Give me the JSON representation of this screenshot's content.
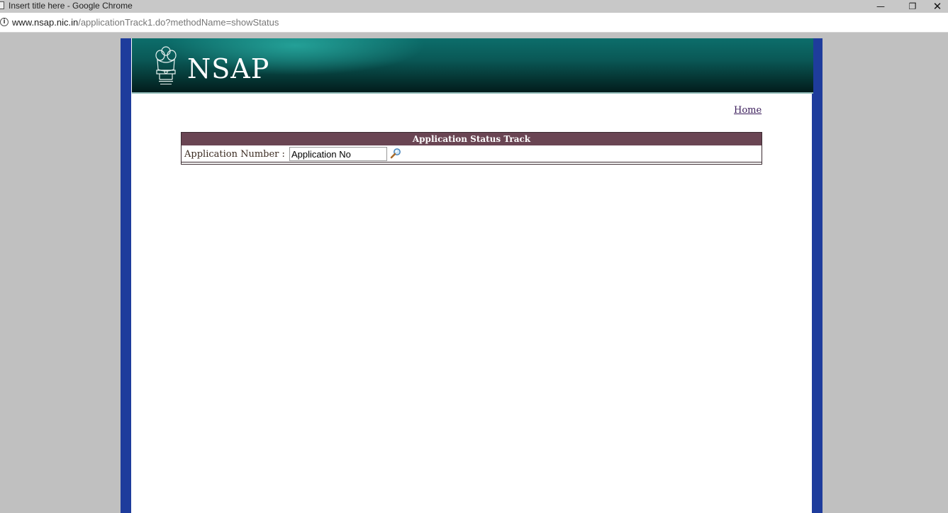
{
  "window": {
    "title": "Insert title here - Google Chrome",
    "minimize_glyph": "—",
    "restore_glyph": "❐",
    "close_glyph": "✕"
  },
  "address_bar": {
    "info_glyph": "i",
    "url_host": "www.nsap.nic.in",
    "url_path": "/applicationTrack1.do?methodName=showStatus"
  },
  "banner": {
    "logo_text": "NSAP",
    "emblem_icon": "national-emblem-icon"
  },
  "nav": {
    "home_label": "Home"
  },
  "status_track": {
    "header": "Application Status Track",
    "application_number_label": "Application Number :",
    "application_number_value": "Application No",
    "search_icon": "magnifier-icon"
  },
  "colors": {
    "frame_blue": "#1e3c9c",
    "header_bar": "#6a4553",
    "banner_teal": "#0a5856",
    "link": "#3b1d5b"
  }
}
